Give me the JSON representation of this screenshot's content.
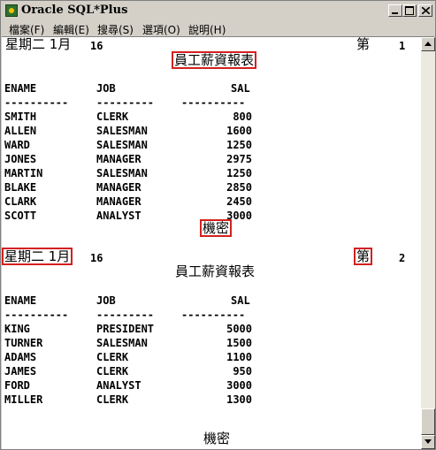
{
  "window": {
    "title": "Oracle SQL*Plus",
    "icon": "sqlplus-app-icon"
  },
  "menu": [
    "檔案(F)",
    "編輯(E)",
    "搜尋(S)",
    "選項(O)",
    "說明(H)"
  ],
  "page1": {
    "date": "星期二 1月",
    "day": "16",
    "page_label": "第",
    "page_no": "1",
    "report_title": "員工薪資報表",
    "headers": [
      "ENAME",
      "JOB",
      "SAL"
    ],
    "dashes": [
      "----------",
      "---------",
      "----------"
    ],
    "rows": [
      [
        "SMITH",
        "CLERK",
        "800"
      ],
      [
        "ALLEN",
        "SALESMAN",
        "1600"
      ],
      [
        "WARD",
        "SALESMAN",
        "1250"
      ],
      [
        "JONES",
        "MANAGER",
        "2975"
      ],
      [
        "MARTIN",
        "SALESMAN",
        "1250"
      ],
      [
        "BLAKE",
        "MANAGER",
        "2850"
      ],
      [
        "CLARK",
        "MANAGER",
        "2450"
      ],
      [
        "SCOTT",
        "ANALYST",
        "3000"
      ]
    ],
    "footer": "機密"
  },
  "page2": {
    "date": "星期二 1月",
    "day": "16",
    "page_label": "第",
    "page_no": "2",
    "report_title": "員工薪資報表",
    "headers": [
      "ENAME",
      "JOB",
      "SAL"
    ],
    "dashes": [
      "----------",
      "---------",
      "----------"
    ],
    "rows": [
      [
        "KING",
        "PRESIDENT",
        "5000"
      ],
      [
        "TURNER",
        "SALESMAN",
        "1500"
      ],
      [
        "ADAMS",
        "CLERK",
        "1100"
      ],
      [
        "JAMES",
        "CLERK",
        "950"
      ],
      [
        "FORD",
        "ANALYST",
        "3000"
      ],
      [
        "MILLER",
        "CLERK",
        "1300"
      ]
    ],
    "footer": "機密"
  },
  "colors": {
    "highlight": "#d42020",
    "chrome": "#d4d0c8"
  }
}
